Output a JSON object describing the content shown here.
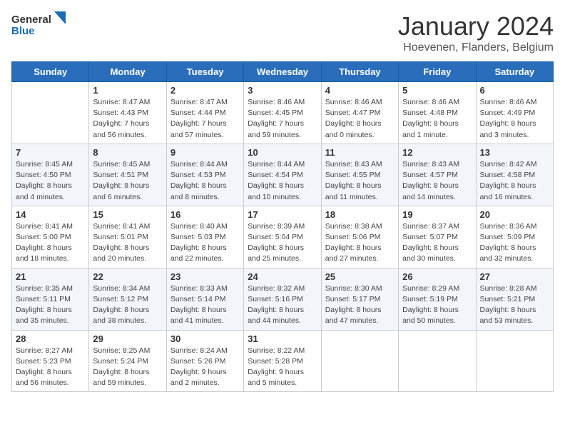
{
  "header": {
    "logo_general": "General",
    "logo_blue": "Blue",
    "title": "January 2024",
    "subtitle": "Hoevenen, Flanders, Belgium"
  },
  "days_of_week": [
    "Sunday",
    "Monday",
    "Tuesday",
    "Wednesday",
    "Thursday",
    "Friday",
    "Saturday"
  ],
  "weeks": [
    [
      {
        "day": "",
        "info": ""
      },
      {
        "day": "1",
        "info": "Sunrise: 8:47 AM\nSunset: 4:43 PM\nDaylight: 7 hours\nand 56 minutes."
      },
      {
        "day": "2",
        "info": "Sunrise: 8:47 AM\nSunset: 4:44 PM\nDaylight: 7 hours\nand 57 minutes."
      },
      {
        "day": "3",
        "info": "Sunrise: 8:46 AM\nSunset: 4:45 PM\nDaylight: 7 hours\nand 59 minutes."
      },
      {
        "day": "4",
        "info": "Sunrise: 8:46 AM\nSunset: 4:47 PM\nDaylight: 8 hours\nand 0 minutes."
      },
      {
        "day": "5",
        "info": "Sunrise: 8:46 AM\nSunset: 4:48 PM\nDaylight: 8 hours\nand 1 minute."
      },
      {
        "day": "6",
        "info": "Sunrise: 8:46 AM\nSunset: 4:49 PM\nDaylight: 8 hours\nand 3 minutes."
      }
    ],
    [
      {
        "day": "7",
        "info": "Sunrise: 8:45 AM\nSunset: 4:50 PM\nDaylight: 8 hours\nand 4 minutes."
      },
      {
        "day": "8",
        "info": "Sunrise: 8:45 AM\nSunset: 4:51 PM\nDaylight: 8 hours\nand 6 minutes."
      },
      {
        "day": "9",
        "info": "Sunrise: 8:44 AM\nSunset: 4:53 PM\nDaylight: 8 hours\nand 8 minutes."
      },
      {
        "day": "10",
        "info": "Sunrise: 8:44 AM\nSunset: 4:54 PM\nDaylight: 8 hours\nand 10 minutes."
      },
      {
        "day": "11",
        "info": "Sunrise: 8:43 AM\nSunset: 4:55 PM\nDaylight: 8 hours\nand 11 minutes."
      },
      {
        "day": "12",
        "info": "Sunrise: 8:43 AM\nSunset: 4:57 PM\nDaylight: 8 hours\nand 14 minutes."
      },
      {
        "day": "13",
        "info": "Sunrise: 8:42 AM\nSunset: 4:58 PM\nDaylight: 8 hours\nand 16 minutes."
      }
    ],
    [
      {
        "day": "14",
        "info": "Sunrise: 8:41 AM\nSunset: 5:00 PM\nDaylight: 8 hours\nand 18 minutes."
      },
      {
        "day": "15",
        "info": "Sunrise: 8:41 AM\nSunset: 5:01 PM\nDaylight: 8 hours\nand 20 minutes."
      },
      {
        "day": "16",
        "info": "Sunrise: 8:40 AM\nSunset: 5:03 PM\nDaylight: 8 hours\nand 22 minutes."
      },
      {
        "day": "17",
        "info": "Sunrise: 8:39 AM\nSunset: 5:04 PM\nDaylight: 8 hours\nand 25 minutes."
      },
      {
        "day": "18",
        "info": "Sunrise: 8:38 AM\nSunset: 5:06 PM\nDaylight: 8 hours\nand 27 minutes."
      },
      {
        "day": "19",
        "info": "Sunrise: 8:37 AM\nSunset: 5:07 PM\nDaylight: 8 hours\nand 30 minutes."
      },
      {
        "day": "20",
        "info": "Sunrise: 8:36 AM\nSunset: 5:09 PM\nDaylight: 8 hours\nand 32 minutes."
      }
    ],
    [
      {
        "day": "21",
        "info": "Sunrise: 8:35 AM\nSunset: 5:11 PM\nDaylight: 8 hours\nand 35 minutes."
      },
      {
        "day": "22",
        "info": "Sunrise: 8:34 AM\nSunset: 5:12 PM\nDaylight: 8 hours\nand 38 minutes."
      },
      {
        "day": "23",
        "info": "Sunrise: 8:33 AM\nSunset: 5:14 PM\nDaylight: 8 hours\nand 41 minutes."
      },
      {
        "day": "24",
        "info": "Sunrise: 8:32 AM\nSunset: 5:16 PM\nDaylight: 8 hours\nand 44 minutes."
      },
      {
        "day": "25",
        "info": "Sunrise: 8:30 AM\nSunset: 5:17 PM\nDaylight: 8 hours\nand 47 minutes."
      },
      {
        "day": "26",
        "info": "Sunrise: 8:29 AM\nSunset: 5:19 PM\nDaylight: 8 hours\nand 50 minutes."
      },
      {
        "day": "27",
        "info": "Sunrise: 8:28 AM\nSunset: 5:21 PM\nDaylight: 8 hours\nand 53 minutes."
      }
    ],
    [
      {
        "day": "28",
        "info": "Sunrise: 8:27 AM\nSunset: 5:23 PM\nDaylight: 8 hours\nand 56 minutes."
      },
      {
        "day": "29",
        "info": "Sunrise: 8:25 AM\nSunset: 5:24 PM\nDaylight: 8 hours\nand 59 minutes."
      },
      {
        "day": "30",
        "info": "Sunrise: 8:24 AM\nSunset: 5:26 PM\nDaylight: 9 hours\nand 2 minutes."
      },
      {
        "day": "31",
        "info": "Sunrise: 8:22 AM\nSunset: 5:28 PM\nDaylight: 9 hours\nand 5 minutes."
      },
      {
        "day": "",
        "info": ""
      },
      {
        "day": "",
        "info": ""
      },
      {
        "day": "",
        "info": ""
      }
    ]
  ]
}
